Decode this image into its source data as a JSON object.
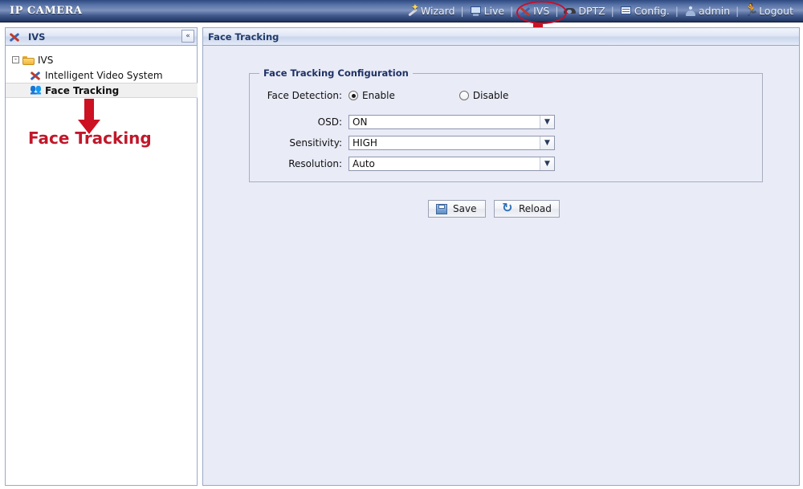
{
  "topbar": {
    "brand": "IP CAMERA",
    "nav": [
      {
        "label": "Wizard",
        "icon": "wand-icon"
      },
      {
        "label": "Live",
        "icon": "monitor-icon"
      },
      {
        "label": "IVS",
        "icon": "ivs-icon"
      },
      {
        "label": "DPTZ",
        "icon": "dome-camera-icon"
      },
      {
        "label": "Config.",
        "icon": "config-icon"
      },
      {
        "label": "admin",
        "icon": "user-icon"
      },
      {
        "label": "Logout",
        "icon": "logout-icon"
      }
    ],
    "separator": "|"
  },
  "annotations": {
    "nav_label": "IVS",
    "sidebar_label": "Face Tracking",
    "highlight_color": "#c8102e"
  },
  "sidebar": {
    "header_title": "IVS",
    "collapse_label": "«",
    "tree": {
      "expander": "-",
      "root_label": "IVS",
      "children": [
        {
          "label": "Intelligent Video System",
          "icon": "ivs-icon",
          "selected": false
        },
        {
          "label": "Face Tracking",
          "icon": "face-tracking-icon",
          "selected": true
        }
      ]
    }
  },
  "content": {
    "header_title": "Face Tracking",
    "fieldset_legend": "Face Tracking Configuration",
    "face_detection": {
      "label": "Face Detection:",
      "options": [
        {
          "label": "Enable",
          "checked": true
        },
        {
          "label": "Disable",
          "checked": false
        }
      ]
    },
    "fields": [
      {
        "label": "OSD:",
        "value": "ON"
      },
      {
        "label": "Sensitivity:",
        "value": "HIGH"
      },
      {
        "label": "Resolution:",
        "value": "Auto"
      }
    ],
    "buttons": [
      {
        "label": "Save",
        "icon": "save-icon"
      },
      {
        "label": "Reload",
        "icon": "reload-icon"
      }
    ]
  }
}
